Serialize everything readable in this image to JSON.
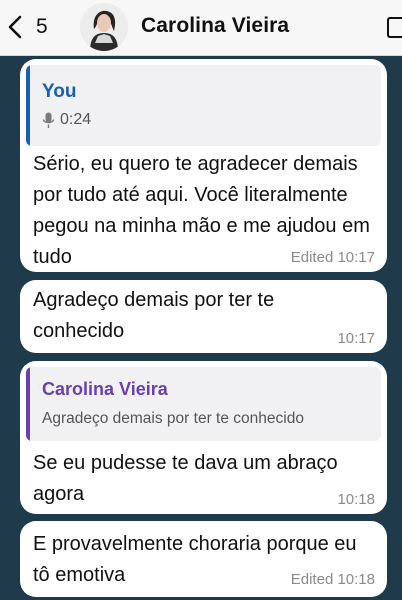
{
  "header": {
    "back_count": "5",
    "contact_name": "Carolina Vieira"
  },
  "messages": [
    {
      "quote_author": "You",
      "quote_text": "0:24",
      "text": "Sério, eu quero te agradecer demais por tudo até aqui. Você literalmente pegou na minha mão e me ajudou em tudo",
      "meta": "Edited 10:17"
    },
    {
      "text": "Agradeço demais por ter te conhecido",
      "meta": "10:17"
    },
    {
      "quote_author": "Carolina Vieira",
      "quote_text": "Agradeço demais por ter te conhecido",
      "text": "Se eu pudesse te dava um abraço agora",
      "meta": "10:18"
    },
    {
      "text": "E provavelmente choraria porque eu tô emotiva",
      "meta": "Edited 10:18"
    }
  ],
  "colors": {
    "background": "#1f3a4a",
    "you_accent": "#1a5fb4",
    "contact_accent": "#6a3fb0"
  }
}
